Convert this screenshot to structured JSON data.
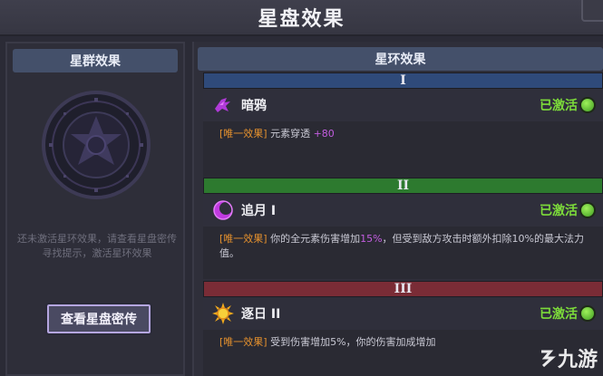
{
  "window": {
    "title": "星盘效果"
  },
  "left": {
    "header": "星群效果",
    "hint": "还未激活星环效果，请查看星盘密传寻找提示，激活星环效果",
    "button_label": "查看星盘密传"
  },
  "right": {
    "header": "星环效果",
    "tiers": [
      {
        "numeral": "I",
        "name": "暗鸦",
        "status": "已激活",
        "icon": "crow-icon",
        "tag": "[唯一效果]",
        "desc_prefix": " 元素穿透 ",
        "desc_highlight": "+80",
        "desc_suffix": ""
      },
      {
        "numeral": "II",
        "name": "追月 I",
        "status": "已激活",
        "icon": "moon-icon",
        "tag": "[唯一效果]",
        "desc_prefix": " 你的全元素伤害增加",
        "desc_highlight": "15%",
        "desc_suffix": "，但受到敌方攻击时额外扣除10%的最大法力值。"
      },
      {
        "numeral": "III",
        "name": "逐日 II",
        "status": "已激活",
        "icon": "sun-icon",
        "tag": "[唯一效果]",
        "desc_prefix": " 受到伤害增加5%，你的伤害加成增加",
        "desc_highlight": "",
        "desc_suffix": ""
      }
    ]
  },
  "watermark": {
    "text": "九游"
  },
  "colors": {
    "active_green": "#7ddc3a",
    "tag_orange": "#e5912e",
    "highlight_purple": "#c35de0",
    "tier1": "#2f4a7a",
    "tier2": "#2d7a2f",
    "tier3": "#7a2c36"
  }
}
